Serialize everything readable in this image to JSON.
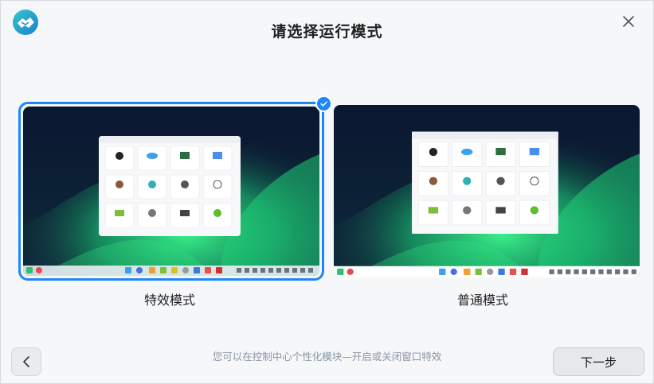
{
  "dialog": {
    "title": "请选择运行模式",
    "hint": "您可以在控制中心个性化模块—开启或关闭窗口特效",
    "next_label": "下一步"
  },
  "modes": [
    {
      "label": "特效模式",
      "selected": true
    },
    {
      "label": "普通模式",
      "selected": false
    }
  ],
  "colors": {
    "accent": "#1e86ff",
    "wallpaper_dark": "#0c1a33",
    "aurora_green": "#2ee07a"
  },
  "icons": {
    "app_logo": "handshake-logo-icon",
    "close": "close-icon",
    "check": "check-icon",
    "back": "chevron-left-icon"
  }
}
